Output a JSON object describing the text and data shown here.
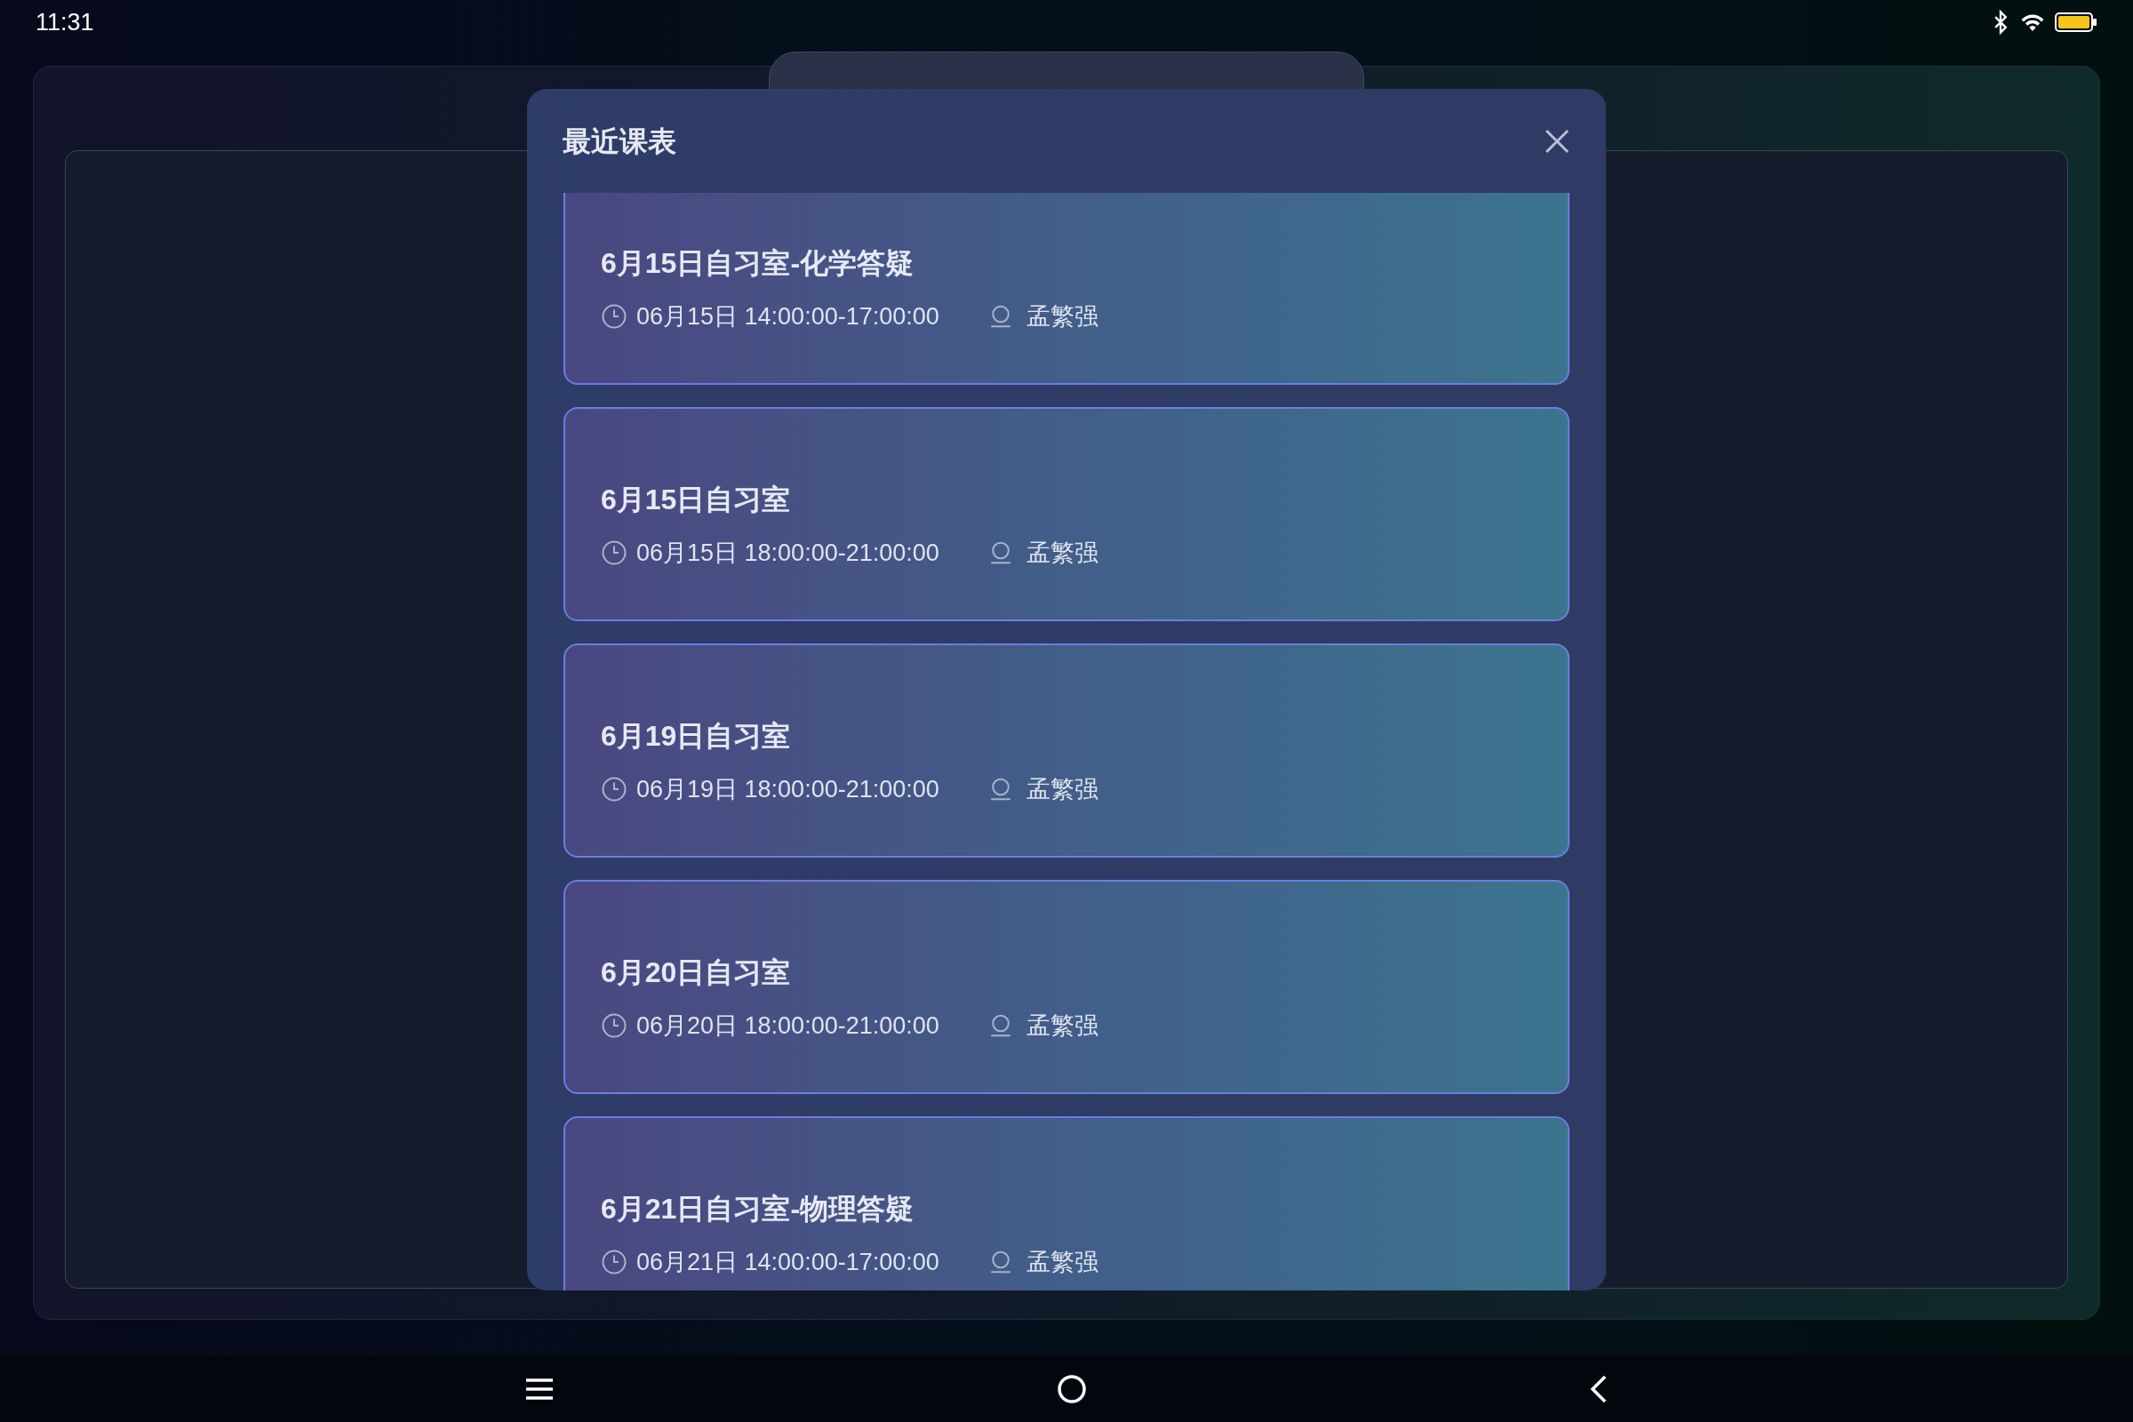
{
  "status_bar": {
    "time": "11:31"
  },
  "dialog": {
    "title": "最近课表",
    "sessions": [
      {
        "title": "6月15日自习室-化学答疑",
        "time": "06月15日 14:00:00-17:00:00",
        "teacher": "孟繁强"
      },
      {
        "title": "6月15日自习室",
        "time": "06月15日 18:00:00-21:00:00",
        "teacher": "孟繁强"
      },
      {
        "title": "6月19日自习室",
        "time": "06月19日 18:00:00-21:00:00",
        "teacher": "孟繁强"
      },
      {
        "title": "6月20日自习室",
        "time": "06月20日 18:00:00-21:00:00",
        "teacher": "孟繁强"
      },
      {
        "title": "6月21日自习室-物理答疑",
        "time": "06月21日 14:00:00-17:00:00",
        "teacher": "孟繁强"
      }
    ]
  }
}
